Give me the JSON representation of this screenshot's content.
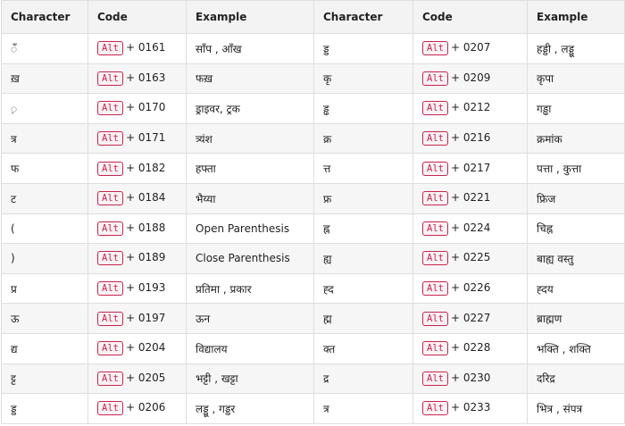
{
  "headers": [
    "Character",
    "Code",
    "Example",
    "Character",
    "Code",
    "Example"
  ],
  "alt_label": "Alt",
  "rows": [
    {
      "c1": "ँ",
      "k1": "+ 0161",
      "e1": "साँप , आँख",
      "c2": "ड्ड",
      "k2": "+ 0207",
      "e2": "हड्डी , लड्डू"
    },
    {
      "c1": "ख़",
      "k1": "+ 0163",
      "e1": "फख़",
      "c2": "कृ",
      "k2": "+ 0209",
      "e2": "कृपा"
    },
    {
      "c1": "़",
      "k1": "+ 0170",
      "e1": "ड्राइवर, ट्रक",
      "c2": "ड्ढ",
      "k2": "+ 0212",
      "e2": "गड्ढा"
    },
    {
      "c1": "त्र",
      "k1": "+ 0171",
      "e1": "त्र्यंश",
      "c2": "क्र",
      "k2": "+ 0216",
      "e2": "क्रमांक"
    },
    {
      "c1": "फ",
      "k1": "+ 0182",
      "e1": "हफ्ता",
      "c2": "त्त",
      "k2": "+ 0217",
      "e2": "पत्ता , कुत्ता"
    },
    {
      "c1": "ट",
      "k1": "+ 0184",
      "e1": "भैय्या",
      "c2": "फ्र",
      "k2": "+ 0221",
      "e2": "फ्रिज"
    },
    {
      "c1": "(",
      "k1": "+ 0188",
      "e1": "Open Parenthesis",
      "c2": "ह्न",
      "k2": "+ 0224",
      "e2": "चिह्न"
    },
    {
      "c1": ")",
      "k1": "+ 0189",
      "e1": "Close Parenthesis",
      "c2": "ह्य",
      "k2": "+ 0225",
      "e2": "बाह्य वस्तु"
    },
    {
      "c1": "प्र",
      "k1": "+ 0193",
      "e1": "प्रतिमा , प्रकार",
      "c2": "ह्द",
      "k2": "+ 0226",
      "e2": "ह्दय"
    },
    {
      "c1": "ऊ",
      "k1": "+ 0197",
      "e1": "ऊन",
      "c2": "ह्म",
      "k2": "+ 0227",
      "e2": "ब्राह्मण"
    },
    {
      "c1": "द्य",
      "k1": "+ 0204",
      "e1": "विद्यालय",
      "c2": "क्त",
      "k2": "+ 0228",
      "e2": "भक्ति , शक्ति"
    },
    {
      "c1": "ट्ट",
      "k1": "+ 0205",
      "e1": "भट्टी , खट्टा",
      "c2": "द्र",
      "k2": "+ 0230",
      "e2": "दरिद्र"
    },
    {
      "c1": "ड्ड",
      "k1": "+ 0206",
      "e1": "लड्डू , गड्डर",
      "c2": "त्र",
      "k2": "+ 0233",
      "e2": "भित्र , संपत्र"
    }
  ]
}
